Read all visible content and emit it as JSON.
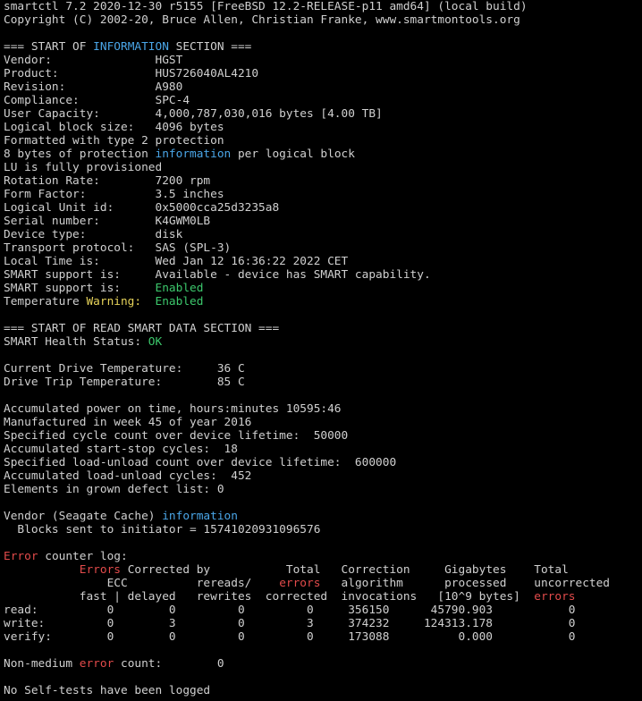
{
  "colors": {
    "background": "#000000",
    "default": "#d0d0d0",
    "blue": "#4aa6e8",
    "green": "#3cc86c",
    "yellow": "#e7d35a",
    "red": "#e34b4b"
  },
  "lines": [
    [
      {
        "t": "smartctl 7.2 2020-12-30 r5155 [FreeBSD 12.2-RELEASE-p11 amd64] (local build)"
      }
    ],
    [
      {
        "t": "Copyright (C) 2002-20, Bruce Allen, Christian Franke, www.smartmontools.org"
      }
    ],
    [],
    [
      {
        "t": "=== START OF "
      },
      {
        "t": "INFORMATION",
        "c": "blue"
      },
      {
        "t": " SECTION ==="
      }
    ],
    [
      {
        "t": "Vendor:               HGST"
      }
    ],
    [
      {
        "t": "Product:              HUS726040AL4210"
      }
    ],
    [
      {
        "t": "Revision:             A980"
      }
    ],
    [
      {
        "t": "Compliance:           SPC-4"
      }
    ],
    [
      {
        "t": "User Capacity:        4,000,787,030,016 bytes [4.00 TB]"
      }
    ],
    [
      {
        "t": "Logical block size:   4096 bytes"
      }
    ],
    [
      {
        "t": "Formatted with type 2 protection"
      }
    ],
    [
      {
        "t": "8 bytes of protection "
      },
      {
        "t": "information",
        "c": "blue"
      },
      {
        "t": " per logical block"
      }
    ],
    [
      {
        "t": "LU is fully provisioned"
      }
    ],
    [
      {
        "t": "Rotation Rate:        7200 rpm"
      }
    ],
    [
      {
        "t": "Form Factor:          3.5 inches"
      }
    ],
    [
      {
        "t": "Logical Unit id:      0x5000cca25d3235a8"
      }
    ],
    [
      {
        "t": "Serial number:        K4GWM0LB"
      }
    ],
    [
      {
        "t": "Device type:          disk"
      }
    ],
    [
      {
        "t": "Transport protocol:   SAS (SPL-3)"
      }
    ],
    [
      {
        "t": "Local Time is:        Wed Jan 12 16:36:22 2022 CET"
      }
    ],
    [
      {
        "t": "SMART support is:     Available - device has SMART capability."
      }
    ],
    [
      {
        "t": "SMART support is:     "
      },
      {
        "t": "Enabled",
        "c": "green"
      }
    ],
    [
      {
        "t": "Temperature "
      },
      {
        "t": "Warning:",
        "c": "yellow"
      },
      {
        "t": "  "
      },
      {
        "t": "Enabled",
        "c": "green"
      }
    ],
    [],
    [
      {
        "t": "=== START OF READ SMART DATA SECTION ==="
      }
    ],
    [
      {
        "t": "SMART Health Status: "
      },
      {
        "t": "OK",
        "c": "green"
      }
    ],
    [],
    [
      {
        "t": "Current Drive Temperature:     36 C"
      }
    ],
    [
      {
        "t": "Drive Trip Temperature:        85 C"
      }
    ],
    [],
    [
      {
        "t": "Accumulated power on time, hours:minutes 10595:46"
      }
    ],
    [
      {
        "t": "Manufactured in week 45 of year 2016"
      }
    ],
    [
      {
        "t": "Specified cycle count over device lifetime:  50000"
      }
    ],
    [
      {
        "t": "Accumulated start-stop cycles:  18"
      }
    ],
    [
      {
        "t": "Specified load-unload count over device lifetime:  600000"
      }
    ],
    [
      {
        "t": "Accumulated load-unload cycles:  452"
      }
    ],
    [
      {
        "t": "Elements in grown defect list: 0"
      }
    ],
    [],
    [
      {
        "t": "Vendor (Seagate Cache) "
      },
      {
        "t": "information",
        "c": "blue"
      }
    ],
    [
      {
        "t": "  Blocks sent to initiator = 15741020931096576"
      }
    ],
    [],
    [
      {
        "t": "Error",
        "c": "red"
      },
      {
        "t": " counter log:"
      }
    ],
    [
      {
        "t": "           "
      },
      {
        "t": "Errors",
        "c": "red"
      },
      {
        "t": " Corrected by           Total   Correction     Gigabytes    Total"
      }
    ],
    [
      {
        "t": "               ECC          rereads/    "
      },
      {
        "t": "errors",
        "c": "red"
      },
      {
        "t": "   algorithm      processed    uncorrected"
      }
    ],
    [
      {
        "t": "           fast | delayed   rewrites  corrected  invocations   [10^9 bytes]  "
      },
      {
        "t": "errors",
        "c": "red"
      }
    ],
    [
      {
        "t": "read:          0        0         0         0     356150      45790.903           0"
      }
    ],
    [
      {
        "t": "write:         0        3         0         3     374232     124313.178           0"
      }
    ],
    [
      {
        "t": "verify:        0        0         0         0     173088          0.000           0"
      }
    ],
    [],
    [
      {
        "t": "Non-medium "
      },
      {
        "t": "error",
        "c": "red"
      },
      {
        "t": " count:        0"
      }
    ],
    [],
    [
      {
        "t": "No Self-tests have been logged"
      }
    ]
  ]
}
